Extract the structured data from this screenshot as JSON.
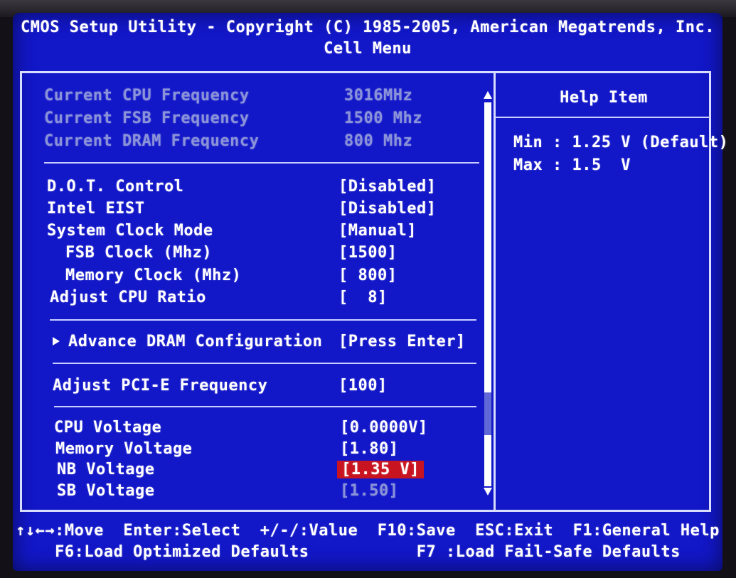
{
  "header": {
    "title": "CMOS Setup Utility - Copyright (C) 1985-2005, American Megatrends, Inc.",
    "menu_name": "Cell Menu"
  },
  "info_rows": [
    {
      "label": "Current CPU Frequency",
      "value": "3016MHz"
    },
    {
      "label": "Current FSB Frequency",
      "value": "1500 Mhz"
    },
    {
      "label": "Current DRAM Frequency",
      "value": "800 Mhz"
    }
  ],
  "settings": [
    {
      "label": "D.O.T. Control",
      "value": "[Disabled]"
    },
    {
      "label": "Intel EIST",
      "value": "[Disabled]"
    },
    {
      "label": "System Clock Mode",
      "value": "[Manual]"
    },
    {
      "label": "FSB Clock (Mhz)",
      "value": "[1500]"
    },
    {
      "label": "Memory Clock (Mhz)",
      "value": "[ 800]"
    },
    {
      "label": "Adjust CPU Ratio",
      "value": "[  8]"
    }
  ],
  "submenu": {
    "label": "Advance DRAM Configuration",
    "value": "[Press Enter]"
  },
  "pcie": {
    "label": "Adjust PCI-E Frequency",
    "value": "[100]"
  },
  "voltages": [
    {
      "label": "CPU Voltage",
      "value": "[0.0000V]"
    },
    {
      "label": "Memory Voltage",
      "value": "[1.80]"
    },
    {
      "label": "NB Voltage",
      "value": "[1.35 V]"
    },
    {
      "label": "SB Voltage",
      "value": "[1.50]"
    }
  ],
  "scroll_position": 0.85,
  "help": {
    "title": "Help Item",
    "lines": [
      "Min : 1.25 V (Default)",
      "Max : 1.5  V"
    ]
  },
  "footer": {
    "line1": "↑↓←→:Move  Enter:Select  +/-/:Value  F10:Save  ESC:Exit  F1:General Help",
    "line2": "F6:Load Optimized Defaults           F7 :Load Fail-Safe Defaults"
  },
  "colors": {
    "background": "#1217c8",
    "highlight": "#c81420",
    "dim_text": "#8a93d8",
    "text": "#ffffff"
  }
}
